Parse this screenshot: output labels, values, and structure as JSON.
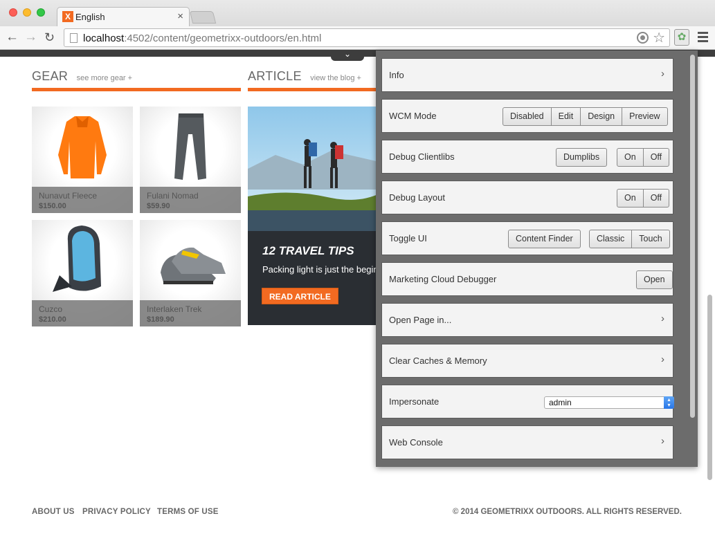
{
  "browser": {
    "tab_title": "English",
    "tab_close": "×",
    "url_host": "localhost",
    "url_rest": ":4502/content/geometrixx-outdoors/en.html",
    "icons": [
      "back-arrow-icon",
      "forward-arrow-icon",
      "reload-icon",
      "page-icon",
      "location-target-icon",
      "bookmark-star-icon",
      "extension-icon",
      "menu-icon"
    ]
  },
  "page": {
    "gear": {
      "title": "GEAR",
      "link": "see more gear +"
    },
    "article_section": {
      "title": "ARTICLE",
      "link": "view the blog +"
    },
    "products": [
      {
        "name": "Nunavut Fleece",
        "price": "$150.00"
      },
      {
        "name": "Fulani Nomad",
        "price": "$59.90"
      },
      {
        "name": "Cuzco",
        "price": "$210.00"
      },
      {
        "name": "Interlaken Trek",
        "price": "$189.90"
      }
    ],
    "article": {
      "title": "12 TRAVEL TIPS",
      "text": "Packing light is just the begin",
      "button": "READ ARTICLE"
    },
    "footer": {
      "links": [
        "ABOUT US",
        "PRIVACY POLICY",
        "TERMS OF USE"
      ],
      "copyright": "© 2014 GEOMETRIXX OUTDOORS. ALL RIGHTS RESERVED."
    },
    "accent_color": "#f26a21"
  },
  "panel": {
    "info": {
      "label": "Info",
      "chevron": "›"
    },
    "wcm_mode": {
      "label": "WCM Mode",
      "buttons": [
        "Disabled",
        "Edit",
        "Design",
        "Preview"
      ]
    },
    "debug_clientlibs": {
      "label": "Debug Clientlibs",
      "dumplibs": "Dumplibs",
      "on": "On",
      "off": "Off"
    },
    "debug_layout": {
      "label": "Debug Layout",
      "on": "On",
      "off": "Off"
    },
    "toggle_ui": {
      "label": "Toggle UI",
      "content_finder": "Content Finder",
      "classic": "Classic",
      "touch": "Touch"
    },
    "marketing_cloud": {
      "label": "Marketing Cloud Debugger",
      "open": "Open"
    },
    "open_page": {
      "label": "Open Page in...",
      "chevron": "›"
    },
    "clear_caches": {
      "label": "Clear Caches & Memory",
      "chevron": "›"
    },
    "impersonate": {
      "label": "Impersonate",
      "selected": "admin"
    },
    "web_console": {
      "label": "Web Console",
      "chevron": "›"
    }
  }
}
